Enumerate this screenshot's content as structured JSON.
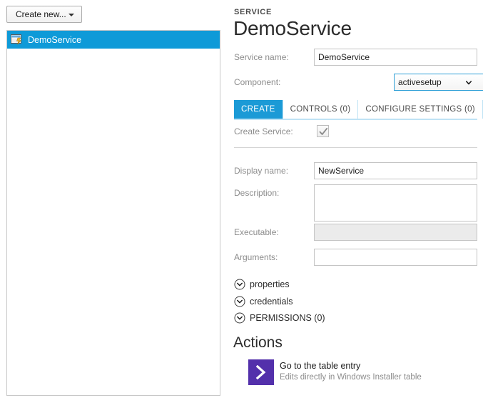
{
  "colors": {
    "accent_blue": "#1b9ad6",
    "selection_blue": "#0e9ad8",
    "action_purple": "#5330ab",
    "tab_divider": "#bfe3f5",
    "label_gray": "#8c8c8c",
    "disabled_fill": "#ebebeb"
  },
  "left_panel": {
    "create_new_button": {
      "label": "Create new...",
      "arrow_icon": "caret-down-icon"
    },
    "list": {
      "items": [
        {
          "label": "DemoService",
          "icon": "service-window-icon",
          "selected": true
        }
      ]
    }
  },
  "right_panel": {
    "eyebrow": "SERVICE",
    "title": "DemoService",
    "fields": {
      "service_name": {
        "label": "Service name:",
        "value": "DemoService",
        "placeholder": ""
      },
      "component": {
        "label": "Component:",
        "value": "activesetup",
        "icon": "chevron-down-icon"
      },
      "create_service": {
        "label": "Create Service:",
        "checked": true,
        "icon": "checkmark-icon"
      },
      "display_name": {
        "label": "Display name:",
        "value": "NewService",
        "placeholder": ""
      },
      "description": {
        "label": "Description:",
        "value": "",
        "placeholder": ""
      },
      "executable": {
        "label": "Executable:",
        "value": "",
        "placeholder": "",
        "disabled": true
      },
      "arguments": {
        "label": "Arguments:",
        "value": "",
        "placeholder": ""
      }
    },
    "tabs": [
      {
        "label": "CREATE",
        "active": true
      },
      {
        "label": "CONTROLS (0)",
        "active": false
      },
      {
        "label": "CONFIGURE SETTINGS (0)",
        "active": false
      }
    ],
    "expanders": [
      {
        "label": "properties",
        "icon": "circle-chevron-down-icon"
      },
      {
        "label": "credentials",
        "icon": "circle-chevron-down-icon"
      },
      {
        "label": "PERMISSIONS (0)",
        "icon": "circle-chevron-down-icon"
      }
    ],
    "actions": {
      "title": "Actions",
      "items": [
        {
          "icon": "chevron-right-icon",
          "title": "Go to the table entry",
          "subtitle": "Edits directly in Windows Installer table"
        }
      ]
    }
  }
}
